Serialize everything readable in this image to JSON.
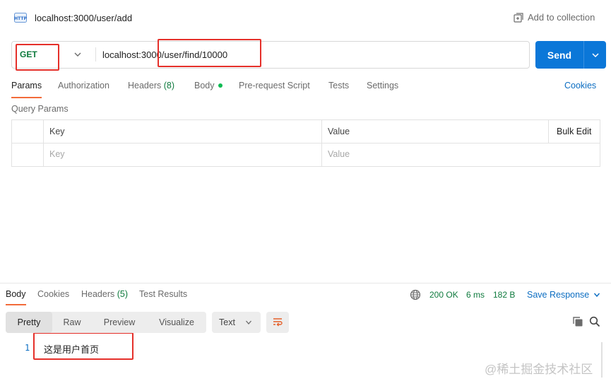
{
  "request": {
    "title": "localhost:3000/user/add",
    "add_to_collection": "Add to collection",
    "method": "GET",
    "url": "localhost:3000/user/find/10000",
    "send_label": "Send"
  },
  "request_tabs": [
    {
      "label": "Params",
      "active": true
    },
    {
      "label": "Authorization"
    },
    {
      "label": "Headers",
      "count": "(8)"
    },
    {
      "label": "Body"
    },
    {
      "label": "Pre-request Script"
    },
    {
      "label": "Tests"
    },
    {
      "label": "Settings"
    }
  ],
  "cookies_label": "Cookies",
  "query_params": {
    "label": "Query Params",
    "columns": {
      "key": "Key",
      "value": "Value"
    },
    "bulk_edit": "Bulk Edit",
    "placeholder": {
      "key": "Key",
      "value": "Value"
    }
  },
  "response": {
    "tabs": [
      {
        "label": "Body",
        "active": true
      },
      {
        "label": "Cookies"
      },
      {
        "label": "Headers",
        "count": "(5)"
      },
      {
        "label": "Test Results"
      }
    ],
    "status": "200 OK",
    "time": "6 ms",
    "size": "182 B",
    "save_response": "Save Response",
    "views": [
      "Pretty",
      "Raw",
      "Preview",
      "Visualize"
    ],
    "format": "Text",
    "line_number": "1",
    "line_text": "这是用户首页"
  },
  "watermark": "@稀土掘金技术社区",
  "colors": {
    "send": "#0b77d8",
    "method": "#0e7a3d",
    "active_tab": "#f26b3a",
    "annotation": "#e5302a"
  }
}
